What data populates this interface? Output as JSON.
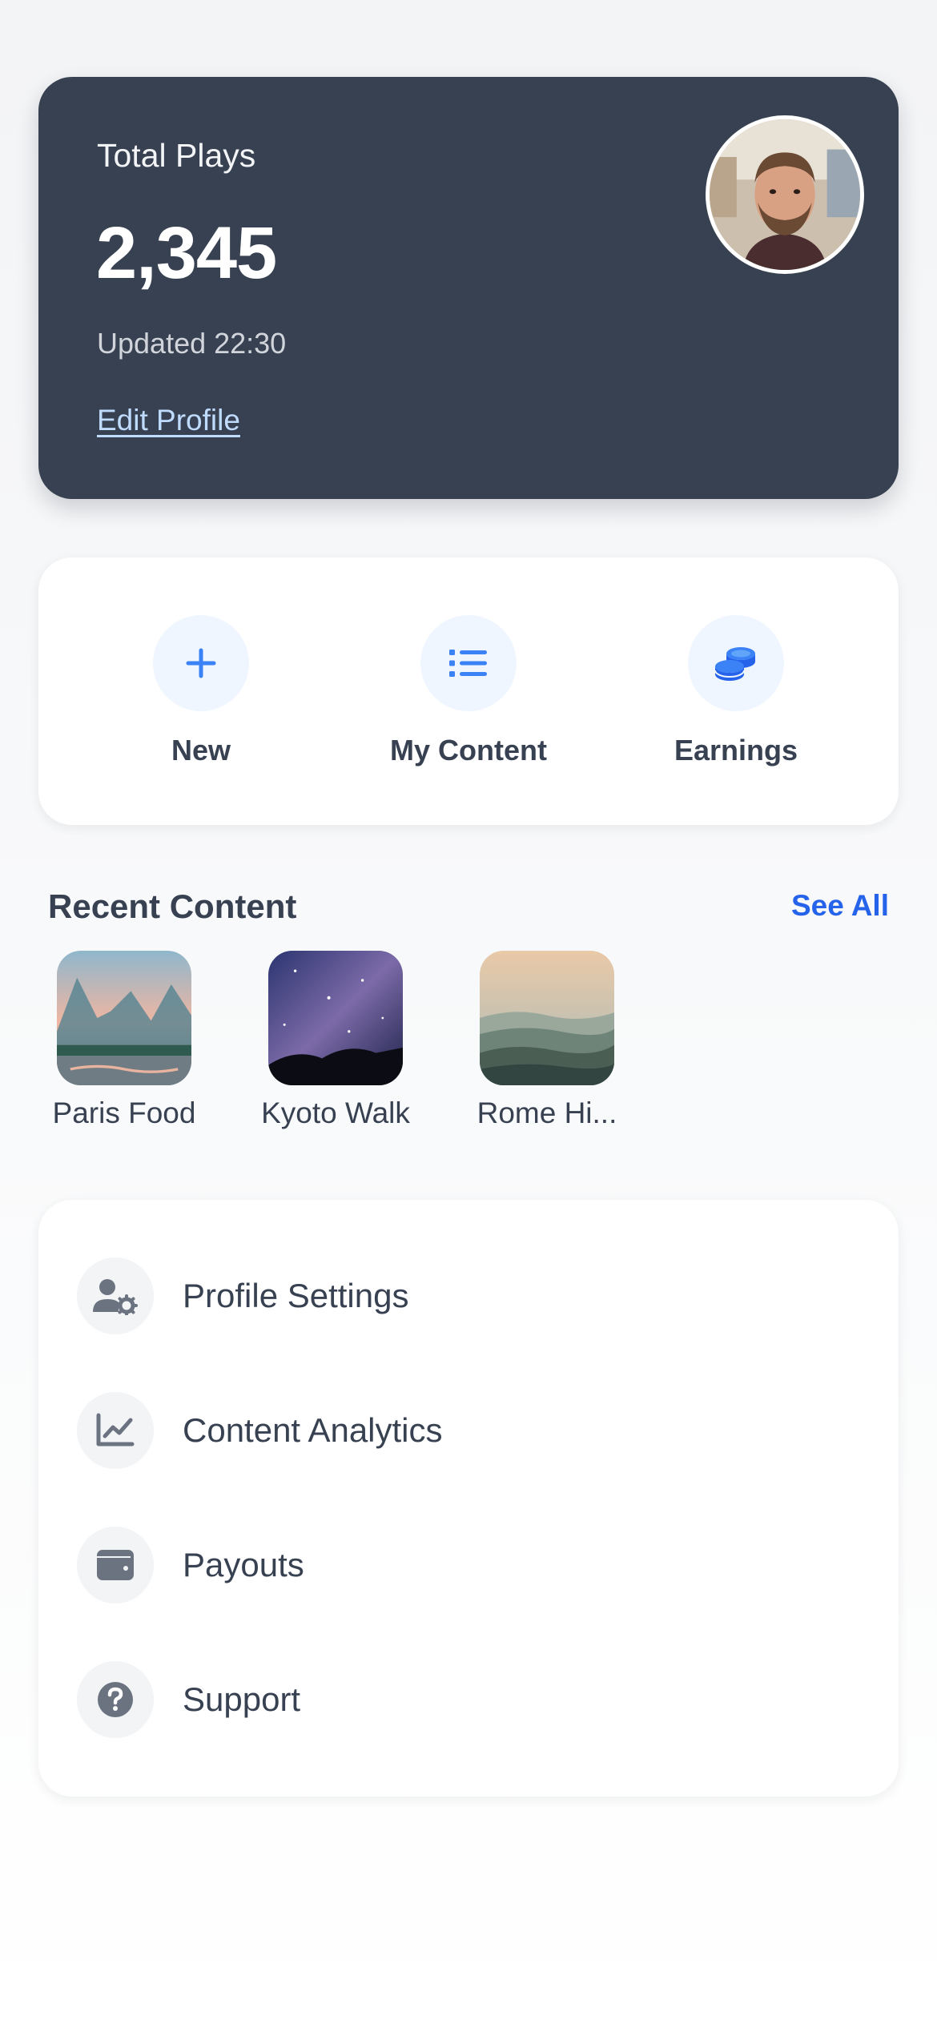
{
  "stats": {
    "label": "Total Plays",
    "value": "2,345",
    "updated": "Updated 22:30",
    "edit_link": "Edit Profile"
  },
  "quick_actions": [
    {
      "label": "New",
      "icon": "plus-icon"
    },
    {
      "label": "My Content",
      "icon": "list-icon"
    },
    {
      "label": "Earnings",
      "icon": "coins-icon"
    }
  ],
  "recent": {
    "title": "Recent Content",
    "see_all": "See All",
    "items": [
      {
        "label": "Paris Food",
        "image": "mountain-lake-thumbnail"
      },
      {
        "label": "Kyoto Walk",
        "image": "night-sky-thumbnail"
      },
      {
        "label": "Rome Hi...",
        "image": "misty-hills-thumbnail"
      }
    ]
  },
  "menu": [
    {
      "label": "Profile Settings",
      "icon": "user-gear-icon"
    },
    {
      "label": "Content Analytics",
      "icon": "chart-line-icon"
    },
    {
      "label": "Payouts",
      "icon": "wallet-icon"
    },
    {
      "label": "Support",
      "icon": "question-circle-icon"
    }
  ],
  "colors": {
    "card_dark": "#374151",
    "accent": "#2563eb",
    "icon_bg": "#eff6ff",
    "menu_icon_bg": "#f3f4f6"
  }
}
